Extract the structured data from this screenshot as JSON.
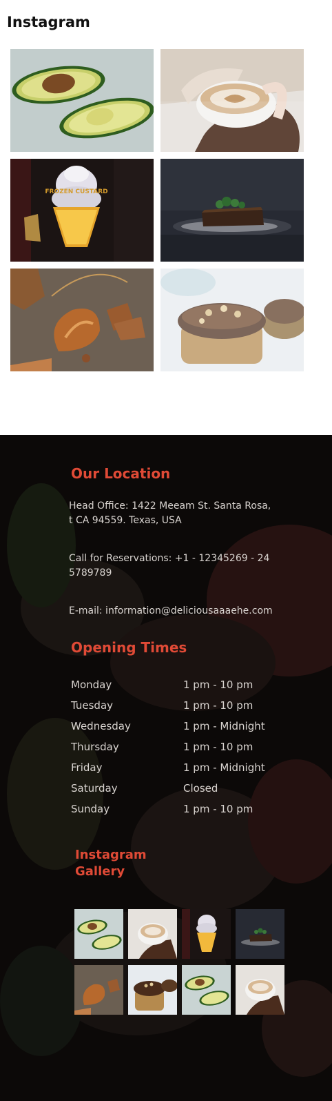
{
  "instagram": {
    "title": "Instagram",
    "tiles": [
      {
        "name": "avocado-photo",
        "icon": "avocado-image"
      },
      {
        "name": "latte-photo",
        "icon": "latte-image"
      },
      {
        "name": "frozen-custard-sign-photo",
        "icon": "ice-cream-sign-image",
        "sign_text": "FROZEN CUSTARD"
      },
      {
        "name": "brownie-photo",
        "icon": "brownie-image"
      },
      {
        "name": "croissant-photo",
        "icon": "croissant-image"
      },
      {
        "name": "donut-cake-photo",
        "icon": "donut-cake-image"
      }
    ]
  },
  "location": {
    "heading": "Our Location",
    "address_line1": "Head Office: 1422 Meeam St. Santa Rosa,",
    "address_line2": "t CA 94559. Texas, USA",
    "phone_line1": "Call for Reservations: +1 - 12345269 - 24",
    "phone_line2": "5789789",
    "email": "E-mail: information@deliciousaaaehe.com"
  },
  "opening_times": {
    "heading": "Opening Times",
    "rows": [
      {
        "day": "Monday",
        "time": "1 pm - 10 pm"
      },
      {
        "day": "Tuesday",
        "time": "1 pm - 10 pm"
      },
      {
        "day": "Wednesday",
        "time": "1 pm - Midnight"
      },
      {
        "day": "Thursday",
        "time": "1 pm - 10 pm"
      },
      {
        "day": "Friday",
        "time": "1 pm - Midnight"
      },
      {
        "day": "Saturday",
        "time": "Closed"
      },
      {
        "day": "Sunday",
        "time": "1 pm - 10 pm"
      }
    ]
  },
  "gallery": {
    "heading_line1": "Instagram",
    "heading_line2": "Gallery"
  },
  "colors": {
    "accent": "#e04a36",
    "footer_bg": "#0c0908",
    "footer_text": "#d9d4d0"
  }
}
